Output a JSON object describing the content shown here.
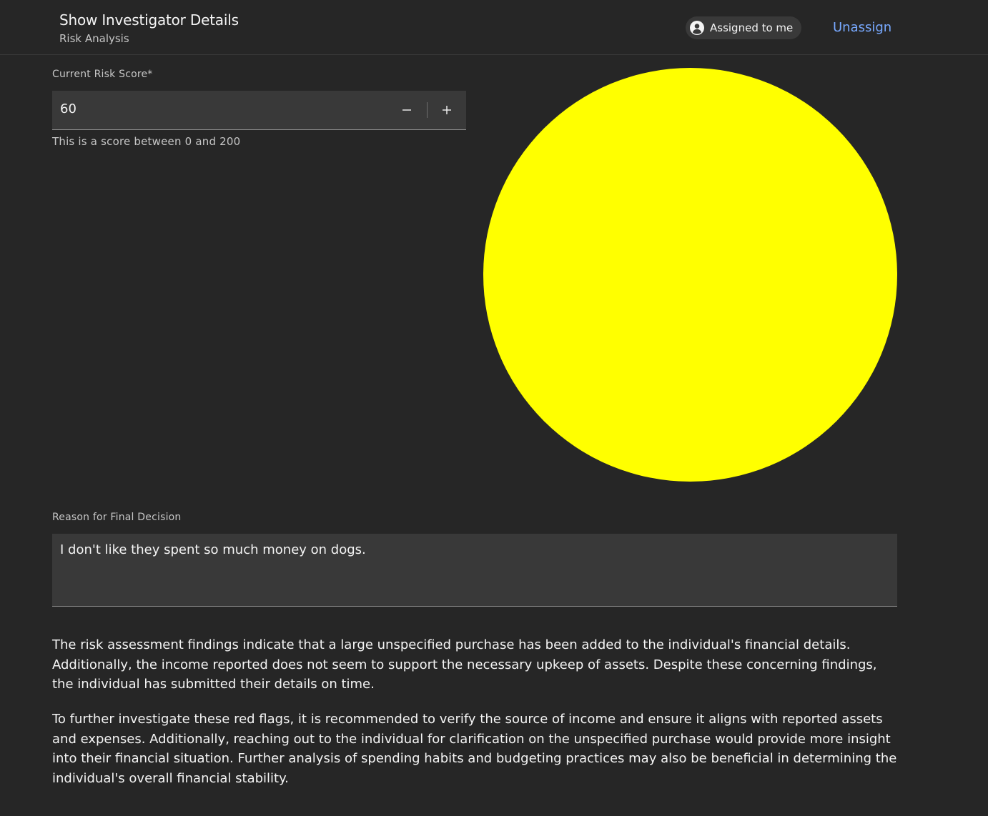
{
  "header": {
    "title": "Show Investigator Details",
    "subtitle": "Risk Analysis",
    "assigned_label": "Assigned to me",
    "assigned_icon": "user-avatar-icon",
    "unassign_label": "Unassign"
  },
  "risk_score": {
    "label": "Current Risk Score*",
    "value": "60",
    "decrement_symbol": "−",
    "increment_symbol": "+",
    "helper": "This is a score between 0 and 200",
    "min": 0,
    "max": 200
  },
  "indicator": {
    "color": "#ffff00"
  },
  "reason": {
    "label": "Reason for Final Decision",
    "value": "I don't like they spent so much money on dogs."
  },
  "summary": {
    "paragraph_1": "The risk assessment findings indicate that a large unspecified purchase has been added to the individual's financial details. Additionally, the income reported does not seem to support the necessary upkeep of assets. Despite these concerning findings, the individual has submitted their details on time.",
    "paragraph_2": "To further investigate these red flags, it is recommended to verify the source of income and ensure it aligns with reported assets and expenses. Additionally, reaching out to the individual for clarification on the unspecified purchase would provide more insight into their financial situation. Further analysis of spending habits and budgeting practices may also be beneficial in determining the individual's overall financial stability."
  },
  "colors": {
    "background": "#262626",
    "field": "#393939",
    "link": "#78a9ff",
    "indicator": "#ffff00"
  }
}
